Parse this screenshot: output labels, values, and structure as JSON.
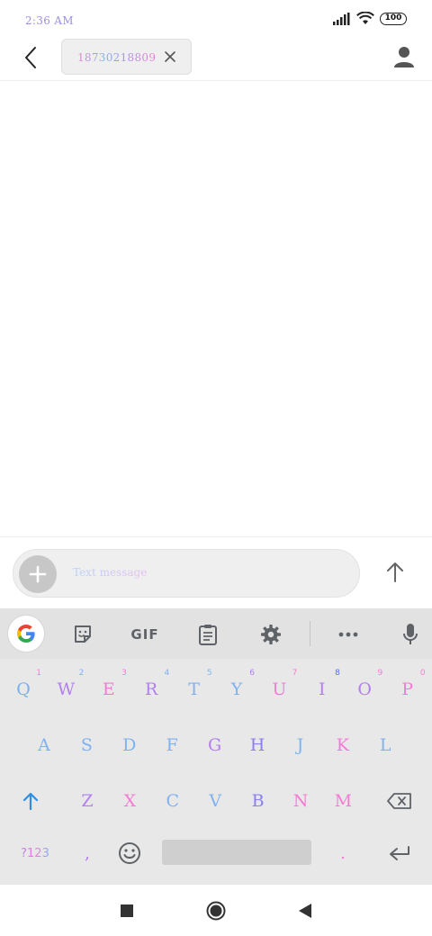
{
  "status_bar": {
    "time": "2:36 AM",
    "battery": "100"
  },
  "header": {
    "recipient_number": "18730218809"
  },
  "composer": {
    "placeholder": "Text message"
  },
  "keyboard": {
    "toolbar": {
      "gif_label": "GIF"
    },
    "row1": [
      {
        "key": "Q",
        "hint": "1",
        "color": "#7ab0f2",
        "hint_color": "#f47bd5"
      },
      {
        "key": "W",
        "hint": "2",
        "color": "#b27ef0",
        "hint_color": "#7fb2f0"
      },
      {
        "key": "E",
        "hint": "3",
        "color": "#f47bd5",
        "hint_color": "#f47bd5"
      },
      {
        "key": "R",
        "hint": "4",
        "color": "#b27ef0",
        "hint_color": "#7fb2f0"
      },
      {
        "key": "T",
        "hint": "5",
        "color": "#7fb2f0",
        "hint_color": "#7fb2f0"
      },
      {
        "key": "Y",
        "hint": "6",
        "color": "#7fb2f0",
        "hint_color": "#b27ef0"
      },
      {
        "key": "U",
        "hint": "7",
        "color": "#f47bd5",
        "hint_color": "#f47bd5"
      },
      {
        "key": "I",
        "hint": "8",
        "color": "#b27ef0",
        "hint_color": "#5b6cf0"
      },
      {
        "key": "O",
        "hint": "9",
        "color": "#b27ef0",
        "hint_color": "#f47bd5"
      },
      {
        "key": "P",
        "hint": "0",
        "color": "#f47bd5",
        "hint_color": "#f47bd5"
      }
    ],
    "row2": [
      {
        "key": "A",
        "color": "#7fb2f0"
      },
      {
        "key": "S",
        "color": "#7fb2f0"
      },
      {
        "key": "D",
        "color": "#7fb2f0"
      },
      {
        "key": "F",
        "color": "#7fb2f0"
      },
      {
        "key": "G",
        "color": "#b27ef0"
      },
      {
        "key": "H",
        "color": "#8b7ef0"
      },
      {
        "key": "J",
        "color": "#7fb2f0"
      },
      {
        "key": "K",
        "color": "#f47bd5"
      },
      {
        "key": "L",
        "color": "#7fb2f0"
      }
    ],
    "row3": [
      {
        "key": "Z",
        "color": "#b27ef0"
      },
      {
        "key": "X",
        "color": "#f47bd5"
      },
      {
        "key": "C",
        "color": "#7fb2f0"
      },
      {
        "key": "V",
        "color": "#7fb2f0"
      },
      {
        "key": "B",
        "color": "#8b7ef0"
      },
      {
        "key": "N",
        "color": "#f47bd5"
      },
      {
        "key": "M",
        "color": "#f47bd5"
      }
    ],
    "symbols_label": "?123",
    "comma": ",",
    "period": "."
  }
}
